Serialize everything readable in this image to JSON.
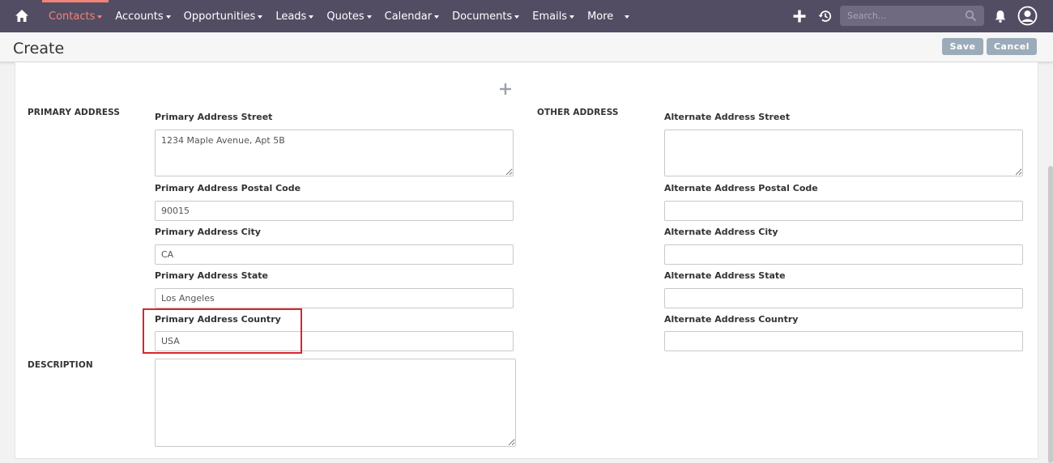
{
  "nav": {
    "items": [
      {
        "label": "Contacts",
        "active": true
      },
      {
        "label": "Accounts"
      },
      {
        "label": "Opportunities"
      },
      {
        "label": "Leads"
      },
      {
        "label": "Quotes"
      },
      {
        "label": "Calendar"
      },
      {
        "label": "Documents"
      },
      {
        "label": "Emails"
      },
      {
        "label": "More"
      }
    ],
    "search_placeholder": "Search...",
    "icons": [
      "home-icon",
      "plus-icon",
      "history-icon",
      "search-icon",
      "bell-icon",
      "user-avatar-icon"
    ],
    "colors": {
      "bar": "#534d64",
      "active": "#f08377"
    }
  },
  "header": {
    "title": "Create",
    "save_label": "Save",
    "cancel_label": "Cancel"
  },
  "primary": {
    "section_label": "PRIMARY ADDRESS",
    "street_label": "Primary Address Street",
    "street_value": "1234 Maple Avenue, Apt 5B",
    "postal_label": "Primary Address Postal Code",
    "postal_value": "90015",
    "city_label": "Primary Address City",
    "city_value": "CA",
    "state_label": "Primary Address State",
    "state_value": "Los Angeles",
    "country_label": "Primary Address Country",
    "country_value": "USA"
  },
  "other": {
    "section_label": "OTHER ADDRESS",
    "street_label": "Alternate Address Street",
    "street_value": "",
    "postal_label": "Alternate Address Postal Code",
    "postal_value": "",
    "city_label": "Alternate Address City",
    "city_value": "",
    "state_label": "Alternate Address State",
    "state_value": "",
    "country_label": "Alternate Address Country",
    "country_value": ""
  },
  "description": {
    "section_label": "DESCRIPTION",
    "value": ""
  }
}
